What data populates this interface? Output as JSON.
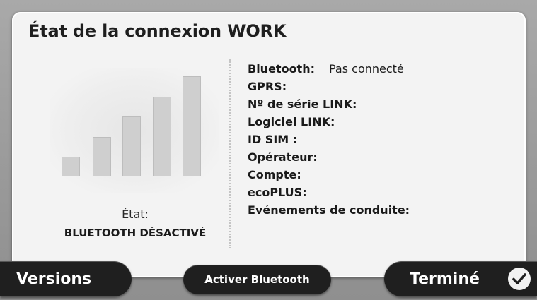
{
  "window": {
    "title": "État de la connexion WORK"
  },
  "signal": {
    "level": 5,
    "max": 5,
    "icon": "signal-strength-icon"
  },
  "state": {
    "label": "État:",
    "value": "BLUETOOTH DÉSACTIVÉ"
  },
  "info": [
    {
      "label": "Bluetooth:",
      "value": "Pas connecté"
    },
    {
      "label": "GPRS:",
      "value": ""
    },
    {
      "label": "Nº de série LINK:",
      "value": ""
    },
    {
      "label": "Logiciel LINK:",
      "value": ""
    },
    {
      "label": "ID SIM :",
      "value": ""
    },
    {
      "label": "Opérateur:",
      "value": ""
    },
    {
      "label": "Compte:",
      "value": ""
    },
    {
      "label": "ecoPLUS:",
      "value": ""
    },
    {
      "label": "Evénements de conduite:",
      "value": ""
    }
  ],
  "buttons": {
    "versions": "Versions",
    "activate": "Activer Bluetooth",
    "done": "Terminé",
    "done_icon": "checkmark-icon"
  },
  "colors": {
    "button_bg": "#1f1f1f",
    "panel_bg": "#f3f3f3",
    "bar_fill": "#cfcfcf"
  }
}
